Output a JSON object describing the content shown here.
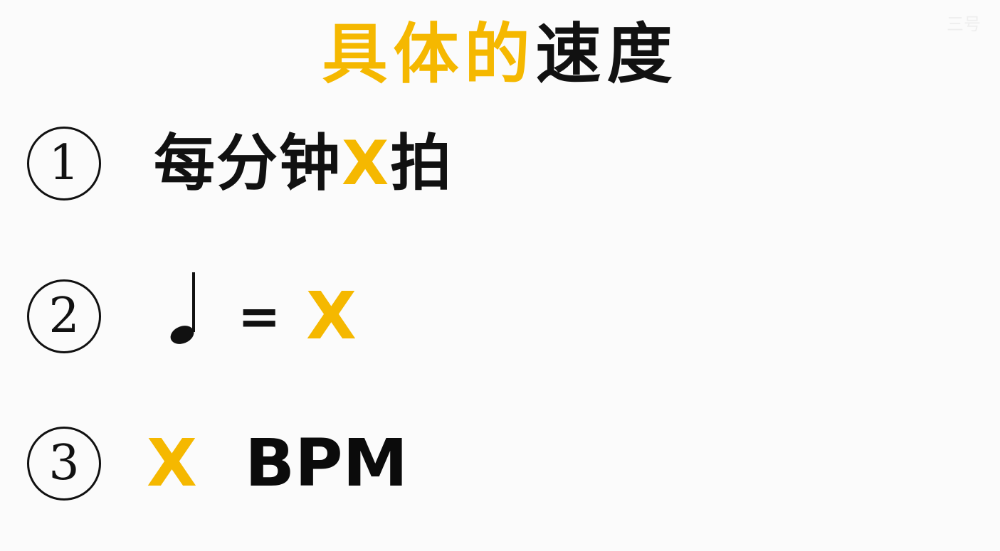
{
  "title": {
    "part1": "具体的",
    "part2": "速度"
  },
  "items": [
    {
      "number": "①",
      "text": "每分钟",
      "highlight": "X",
      "suffix": "拍"
    },
    {
      "number": "②",
      "note_icon": "quarter-note-icon",
      "equals": "=",
      "highlight": "X"
    },
    {
      "number": "③",
      "highlight": "X",
      "unit": "BPM"
    }
  ],
  "watermark": "三号",
  "colors": {
    "accent": "#f5b800",
    "text": "#111111",
    "background": "#fbfbfb"
  }
}
